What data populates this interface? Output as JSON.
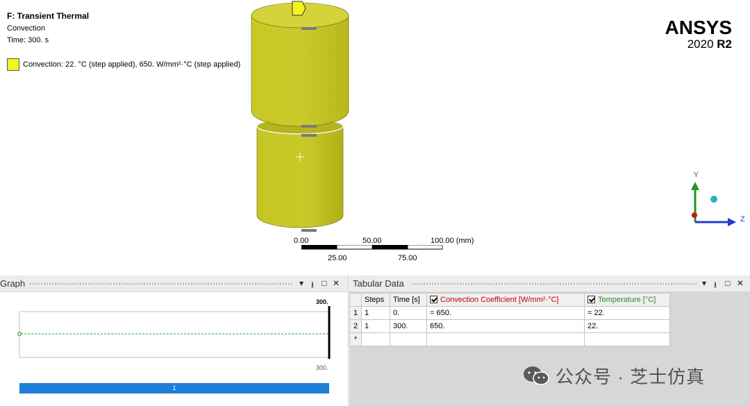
{
  "viewport": {
    "title": "F: Transient Thermal",
    "subtitle": "Convection",
    "time_label": "Time: 300. s",
    "legend_text": "Convection: 22. °C  (step applied), 650. W/mm²·°C  (step applied)",
    "legend_color": "#f5f51e",
    "model_color": "#c8c828",
    "logo": {
      "name": "ANSYS",
      "version": "2020",
      "release": "R2"
    },
    "scale_bar": {
      "top_labels": [
        "0.00",
        "50.00",
        "100.00 (mm)"
      ],
      "bottom_labels": [
        "25.00",
        "75.00"
      ]
    },
    "triad": {
      "y_label": "Y",
      "z_label": "Z"
    }
  },
  "graph_panel": {
    "title": "Graph",
    "top_value": "300.",
    "bottom_value": "300.",
    "timeline_step": "1",
    "timeline_color": "#1e7fd8"
  },
  "tabular_panel": {
    "title": "Tabular Data",
    "columns": [
      "Steps",
      "Time [s]",
      "Convection Coefficient [W/mm²·°C]",
      "Temperature [°C]"
    ],
    "convection_color": "#c00000",
    "temperature_color": "#2a8a2a",
    "rows": [
      {
        "num": "1",
        "steps": "1",
        "time": "0.",
        "coef": "= 650.",
        "temp": "= 22."
      },
      {
        "num": "2",
        "steps": "1",
        "time": "300.",
        "coef": "650.",
        "temp": "22."
      }
    ],
    "new_row_marker": "*"
  },
  "panel_buttons": {
    "dropdown": "▾",
    "pin": "⭳",
    "maximize": "□",
    "close": "✕"
  },
  "watermark": "公众号 · 芝士仿真"
}
